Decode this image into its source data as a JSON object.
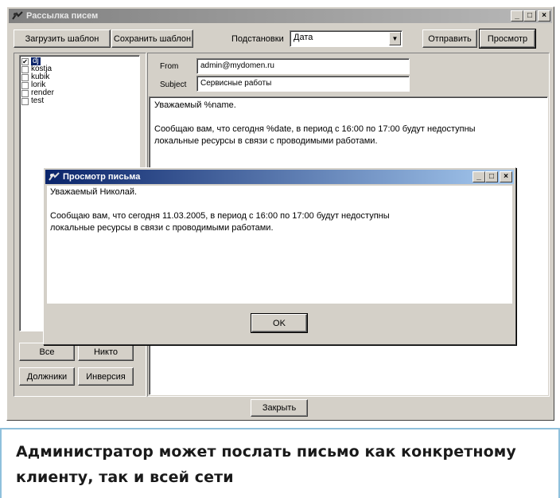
{
  "window": {
    "title": "Рассылка писем",
    "controls": [
      "_",
      "□",
      "×"
    ]
  },
  "toolbar": {
    "load_template": "Загрузить шаблон",
    "save_template": "Сохранить шаблон",
    "substitutions_label": "Подстановки",
    "substitution_value": "Дата",
    "send": "Отправить",
    "preview": "Просмотр"
  },
  "recipients": {
    "items": [
      {
        "label": "dj",
        "checked": true,
        "selected": true
      },
      {
        "label": "kostja",
        "checked": false,
        "selected": false
      },
      {
        "label": "kubik",
        "checked": false,
        "selected": false
      },
      {
        "label": "lorik",
        "checked": false,
        "selected": false
      },
      {
        "label": "render",
        "checked": false,
        "selected": false
      },
      {
        "label": "test",
        "checked": false,
        "selected": false
      }
    ],
    "all": "Все",
    "none": "Никто",
    "debtors": "Должники",
    "invert": "Инверсия"
  },
  "message": {
    "from_label": "From",
    "from_value": "admin@mydomen.ru",
    "subject_label": "Subject",
    "subject_value": "Сервисные работы",
    "body_line1": "Уважаемый %name.",
    "body_line2": "Сообщаю вам, что сегодня %date, в период с 16:00 по 17:00 будут недоступны",
    "body_line3": "локальные ресурсы в связи с проводимыми работами."
  },
  "close_button": "Закрыть",
  "preview_dialog": {
    "title": "Просмотр письма",
    "line1": "Уважаемый Николай.",
    "line2": "Сообщаю вам, что сегодня 11.03.2005, в период с 16:00 по 17:00 будут недоступны",
    "line3": "локальные ресурсы в связи с проводимыми работами.",
    "ok": "OK"
  },
  "caption": {
    "text": "Администратор может послать письмо как конкретному клиенту, так и всей сети"
  }
}
